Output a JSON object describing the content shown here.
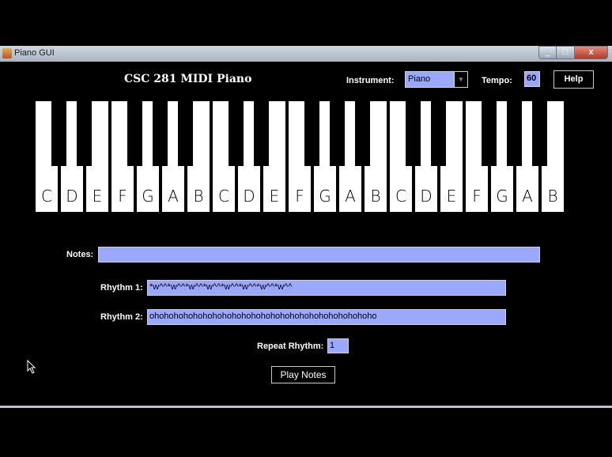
{
  "window": {
    "title": "Piano GUI",
    "minimize": "_",
    "maximize": "□",
    "close": "x"
  },
  "header": {
    "app_title": "CSC 281 MIDI Piano",
    "instrument_label": "Instrument:",
    "instrument_value": "Piano",
    "tempo_label": "Tempo:",
    "tempo_value": "60",
    "help_label": "Help"
  },
  "keyboard": {
    "white_keys": [
      "C",
      "D",
      "E",
      "F",
      "G",
      "A",
      "B",
      "C",
      "D",
      "E",
      "F",
      "G",
      "A",
      "B",
      "C",
      "D",
      "E",
      "F",
      "G",
      "A",
      "B"
    ]
  },
  "form": {
    "notes_label": "Notes:",
    "notes_value": "",
    "rhythm1_label": "Rhythm 1:",
    "rhythm1_value": "*w^^*w^^*w^^*w^^*w^^*w^^*w^^*w^^",
    "rhythm2_label": "Rhythm 2:",
    "rhythm2_value": "ohohohohohohohohohohohohohohohohohohohohohohoho",
    "repeat_label": "Repeat Rhythm:",
    "repeat_value": "1",
    "play_label": "Play Notes"
  },
  "colors": {
    "field_bg": "#9aa8ff",
    "background": "#000000"
  }
}
